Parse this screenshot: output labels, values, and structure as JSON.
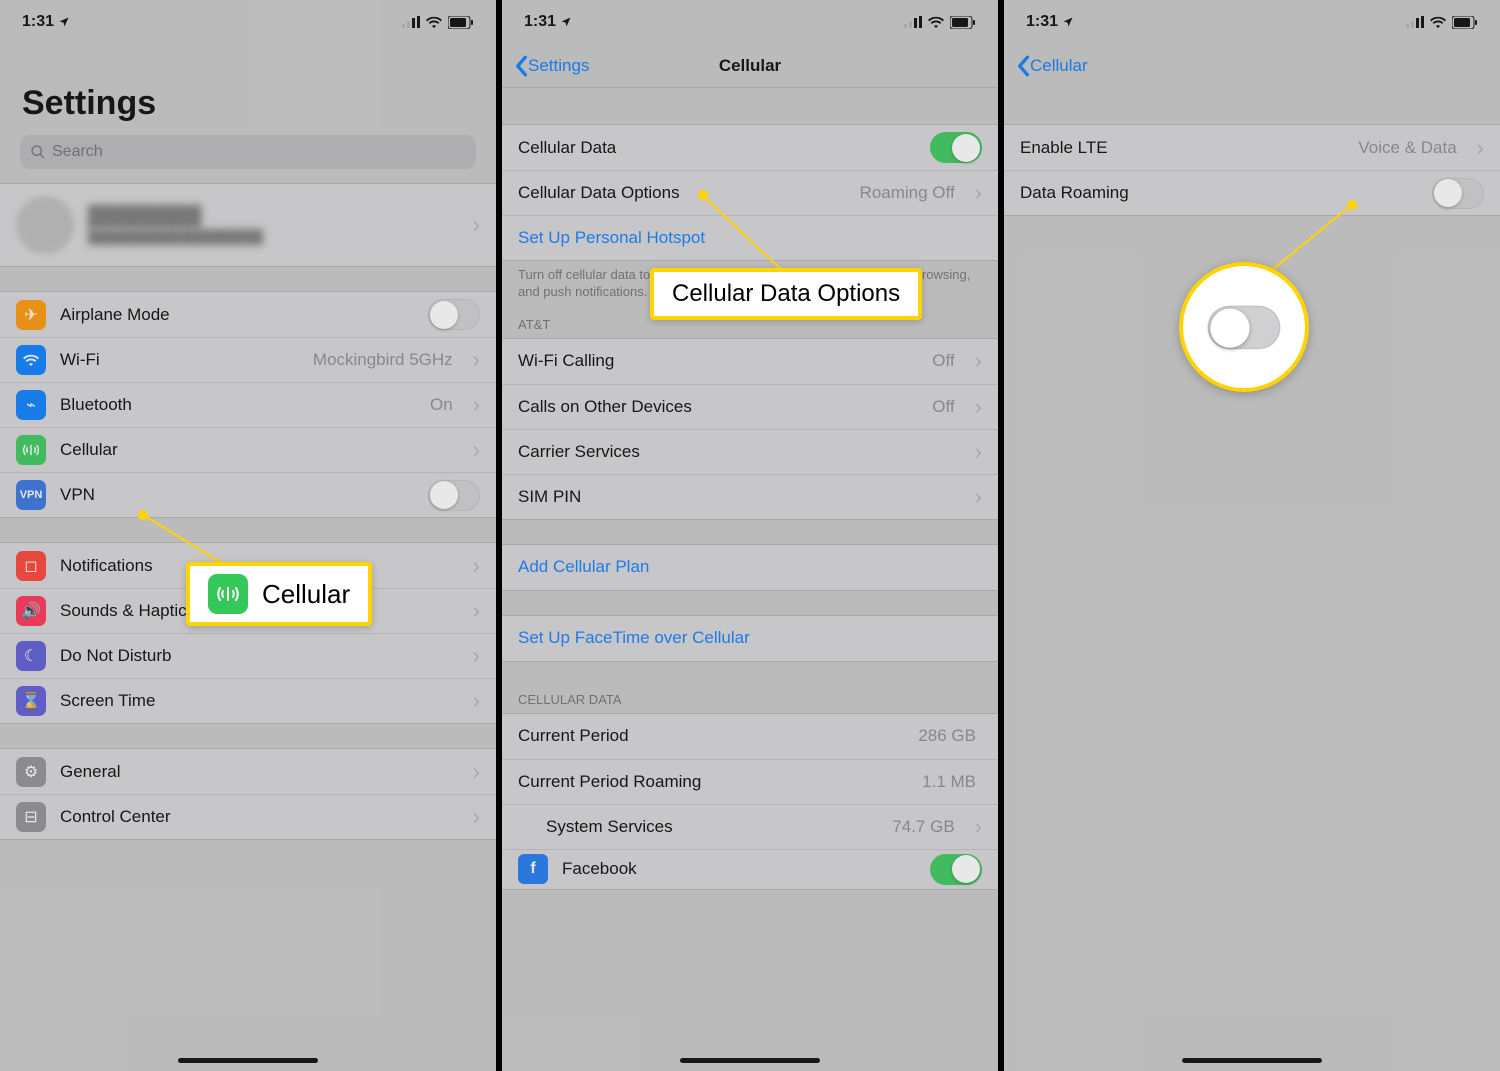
{
  "status": {
    "time": "1:31"
  },
  "screen1": {
    "title": "Settings",
    "search_placeholder": "Search",
    "profile": {
      "name": "████████",
      "subtitle": "███████████████████"
    },
    "rows": {
      "airplane": "Airplane Mode",
      "wifi": "Wi-Fi",
      "wifi_value": "Mockingbird 5GHz",
      "bluetooth": "Bluetooth",
      "bluetooth_value": "On",
      "cellular": "Cellular",
      "vpn": "VPN",
      "notifications": "Notifications",
      "sounds": "Sounds & Haptics",
      "dnd": "Do Not Disturb",
      "screentime": "Screen Time",
      "general": "General",
      "controlcenter": "Control Center"
    },
    "callout": "Cellular"
  },
  "screen2": {
    "back": "Settings",
    "title": "Cellular",
    "rows": {
      "cellular_data": "Cellular Data",
      "cellular_data_options": "Cellular Data Options",
      "cdo_value": "Roaming Off",
      "hotspot": "Set Up Personal Hotspot",
      "footer1": "Turn off cellular data to restrict all data to Wi-Fi, including email, web browsing, and push notifications.",
      "header_carrier": "AT&T",
      "wifi_calling": "Wi-Fi Calling",
      "wifi_calling_value": "Off",
      "calls_other": "Calls on Other Devices",
      "calls_other_value": "Off",
      "carrier_services": "Carrier Services",
      "sim_pin": "SIM PIN",
      "add_plan": "Add Cellular Plan",
      "facetime": "Set Up FaceTime over Cellular",
      "header_data": "CELLULAR DATA",
      "current_period": "Current Period",
      "current_period_value": "286 GB",
      "current_roaming": "Current Period Roaming",
      "current_roaming_value": "1.1 MB",
      "system_services": "System Services",
      "system_services_value": "74.7 GB",
      "facebook": "Facebook"
    },
    "callout": "Cellular Data Options"
  },
  "screen3": {
    "back": "Cellular",
    "rows": {
      "enable_lte": "Enable LTE",
      "enable_lte_value": "Voice & Data",
      "data_roaming": "Data Roaming"
    }
  }
}
